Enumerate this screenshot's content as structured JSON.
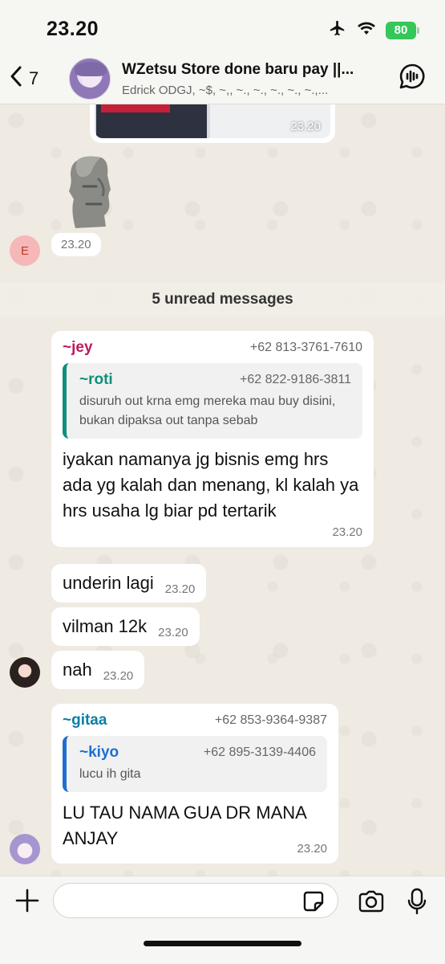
{
  "status_bar": {
    "time": "23.20",
    "battery": "80"
  },
  "header": {
    "back_count": "7",
    "title": "WZetsu Store done baru pay ||...",
    "subtitle": "Edrick ODGJ, ~$, ~,, ~., ~., ~., ~., ~.,..."
  },
  "image_message": {
    "time": "23.20"
  },
  "sticker_message": {
    "time": "23.20",
    "avatar_letter": "E"
  },
  "unread_divider": "5 unread messages",
  "messages": [
    {
      "sender": "~jey",
      "phone": "+62 813-3761-7610",
      "sender_color": "#c2185b",
      "quote": {
        "sender": "~roti",
        "phone": "+62 822-9186-3811",
        "text": "disuruh out krna emg mereka mau buy disini, bukan dipaksa out tanpa sebab",
        "bar_color": "#0e8f7b",
        "sender_color": "#0e8f7b"
      },
      "text": "iyakan namanya jg bisnis emg hrs ada yg kalah dan menang, kl kalah ya hrs usaha lg biar pd tertarik",
      "time": "23.20"
    },
    {
      "text": "underin lagi",
      "time": "23.20"
    },
    {
      "text": "vilman 12k",
      "time": "23.20"
    },
    {
      "text": "nah",
      "time": "23.20"
    },
    {
      "sender": "~gitaa",
      "phone": "+62 853-9364-9387",
      "sender_color": "#0b7fa6",
      "quote": {
        "sender": "~kiyo",
        "phone": "+62 895-3139-4406",
        "text": "lucu ih gita",
        "bar_color": "#1f6fd1",
        "sender_color": "#1f6fd1"
      },
      "text": "LU TAU NAMA GUA DR MANA ANJAY",
      "time": "23.20"
    }
  ],
  "composer": {
    "placeholder": ""
  }
}
